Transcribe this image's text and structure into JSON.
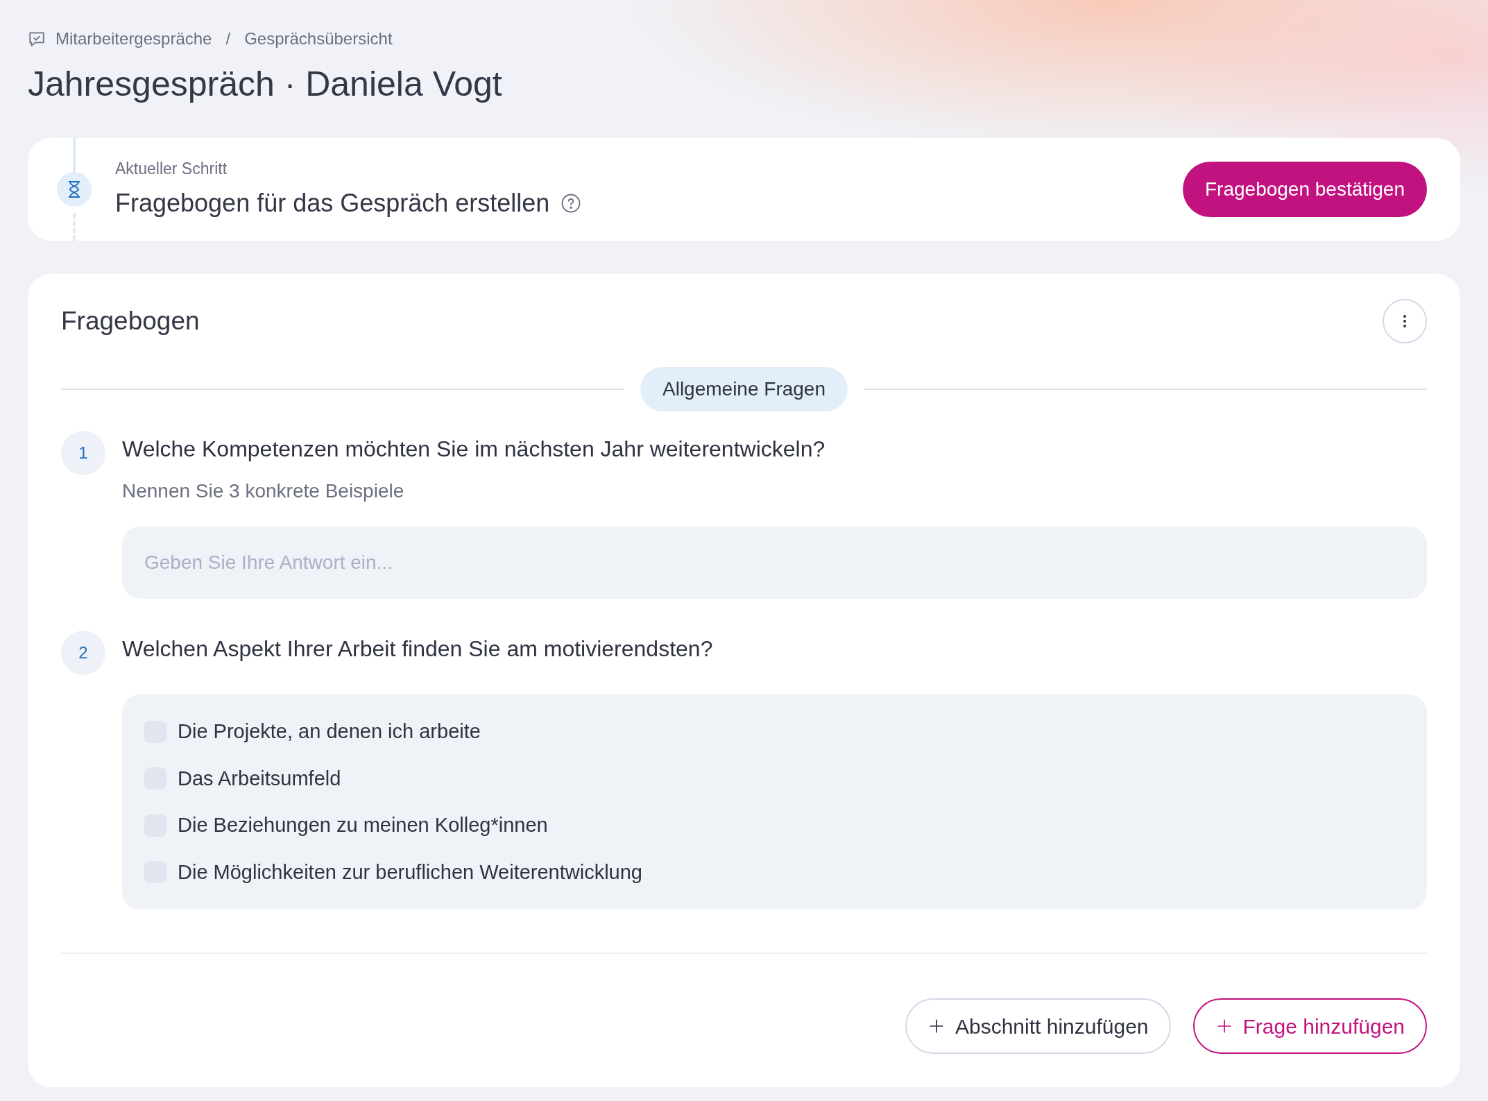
{
  "breadcrumb": [
    "Mitarbeitergespräche",
    "Gesprächsübersicht"
  ],
  "breadcrumb_separator": "/",
  "page_title": "Jahresgespräch · Daniela Vogt",
  "step": {
    "label": "Aktueller Schritt",
    "title": "Fragebogen für das Gespräch erstellen",
    "button": "Fragebogen bestätigen"
  },
  "questionnaire": {
    "title": "Fragebogen",
    "section": "Allgemeine Fragen",
    "questions": [
      {
        "kind": "text",
        "number": "1",
        "question": "Welche Kompetenzen möchten Sie im nächsten Jahr weiterentwickeln?",
        "hint": "Nennen Sie 3 konkrete Beispiele",
        "placeholder": "Geben Sie Ihre Antwort ein..."
      },
      {
        "kind": "choice",
        "number": "2",
        "question": "Welchen Aspekt Ihrer Arbeit finden Sie am motivierendsten?",
        "options": [
          {
            "label": "Die Projekte, an denen ich arbeite",
            "checked": false
          },
          {
            "label": "Das Arbeitsumfeld",
            "checked": false
          },
          {
            "label": "Die Beziehungen zu meinen Kolleg*innen",
            "checked": false
          },
          {
            "label": "Die Möglichkeiten zur beruflichen Weiterentwicklung",
            "checked": false
          }
        ]
      }
    ],
    "buttons": [
      {
        "kind": "secondary",
        "label": "Abschnitt hinzufügen"
      },
      {
        "kind": "primary",
        "label": "Frage hinzufügen"
      }
    ]
  }
}
